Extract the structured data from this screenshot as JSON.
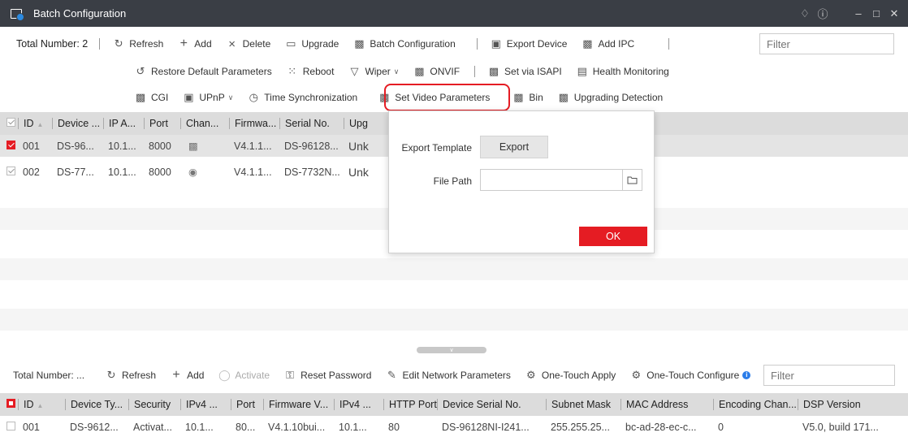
{
  "window": {
    "title": "Batch Configuration",
    "controls": [
      "bell-icon",
      "info-icon",
      "minimize-icon",
      "maximize-icon",
      "close-icon"
    ]
  },
  "top_toolbar": {
    "total_label": "Total Number: 2",
    "row1": [
      {
        "label": "Refresh",
        "icon": "refresh-icon"
      },
      {
        "label": "Add",
        "icon": "plus-icon"
      },
      {
        "label": "Delete",
        "icon": "x-icon"
      },
      {
        "label": "Upgrade",
        "icon": "upgrade-icon"
      },
      {
        "label": "Batch Configuration",
        "icon": "batch-config-icon"
      },
      {
        "label": "Export Device",
        "icon": "export-icon"
      },
      {
        "label": "Add IPC",
        "icon": "add-ipc-icon"
      }
    ],
    "row2": [
      {
        "label": "Restore Default Parameters",
        "icon": "restore-icon"
      },
      {
        "label": "Reboot",
        "icon": "reboot-icon"
      },
      {
        "label": "Wiper",
        "icon": "wiper-icon"
      },
      {
        "label": "ONVIF",
        "icon": "onvif-icon"
      },
      {
        "label": "Set via ISAPI",
        "icon": "isapi-icon"
      },
      {
        "label": "Health Monitoring",
        "icon": "health-icon"
      }
    ],
    "row3": [
      {
        "label": "CGI",
        "icon": "cgi-icon"
      },
      {
        "label": "UPnP",
        "icon": "upnp-icon"
      },
      {
        "label": "Time Synchronization",
        "icon": "clock-icon"
      },
      {
        "label": "Set Video Parameters",
        "icon": "video-params-icon"
      },
      {
        "label": "Bin",
        "icon": "bin-icon"
      },
      {
        "label": "Upgrading Detection",
        "icon": "upgrade-detect-icon"
      }
    ],
    "filter_placeholder": "Filter"
  },
  "top_table": {
    "headers": [
      "ID",
      "Device ...",
      "IP A...",
      "Port",
      "Chan...",
      "Firmwa...",
      "Serial No.",
      "Upg"
    ],
    "rows": [
      {
        "id": "001",
        "device": "DS-96...",
        "ip": "10.1...",
        "port": "8000",
        "chan_icon": "channel-icon",
        "firmware": "V4.1.1...",
        "serial": "DS-96128...",
        "upg": "Unk",
        "checked": true
      },
      {
        "id": "002",
        "device": "DS-77...",
        "ip": "10.1...",
        "port": "8000",
        "chan_icon": "eye-icon",
        "firmware": "V4.1.1...",
        "serial": "DS-7732N...",
        "upg": "Unk",
        "checked": false
      }
    ]
  },
  "dialog": {
    "export_template_label": "Export Template",
    "export_button": "Export",
    "file_path_label": "File Path",
    "file_path_value": "",
    "ok_button": "OK"
  },
  "bottom_toolbar": {
    "total_label": "Total Number: ...",
    "items": [
      {
        "label": "Refresh",
        "icon": "refresh-icon",
        "enabled": true
      },
      {
        "label": "Add",
        "icon": "plus-icon",
        "enabled": true
      },
      {
        "label": "Activate",
        "icon": "shield-icon",
        "enabled": false
      },
      {
        "label": "Reset Password",
        "icon": "key-icon",
        "enabled": true
      },
      {
        "label": "Edit Network Parameters",
        "icon": "edit-icon",
        "enabled": true
      },
      {
        "label": "One-Touch Apply",
        "icon": "gear-icon",
        "enabled": true
      },
      {
        "label": "One-Touch Configure",
        "icon": "gear-icon",
        "enabled": true
      }
    ],
    "filter_placeholder": "Filter"
  },
  "bottom_table": {
    "headers": [
      "ID",
      "Device Ty...",
      "Security",
      "IPv4 ...",
      "Port",
      "Firmware V...",
      "IPv4 ...",
      "HTTP Port",
      "Device Serial No.",
      "Subnet Mask",
      "MAC Address",
      "Encoding Chan...",
      "DSP Version"
    ],
    "rows": [
      {
        "id": "001",
        "device_type": "DS-9612...",
        "security": "Activat...",
        "ipv4": "10.1...",
        "port": "80...",
        "firmware": "V4.1.10bui...",
        "ipv4_gw": "10.1...",
        "http_port": "80",
        "serial": "DS-96128NI-I241...",
        "subnet": "255.255.25...",
        "mac": "bc-ad-28-ec-c...",
        "encoding": "0",
        "dsp": "V5.0, build 171..."
      }
    ]
  },
  "colors": {
    "accent_red": "#e51c23",
    "titlebar": "#3a3e45",
    "header_gray": "#dcdcdc"
  }
}
